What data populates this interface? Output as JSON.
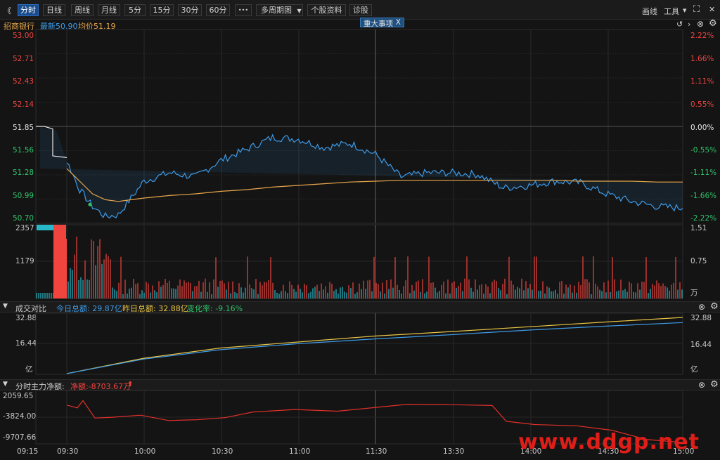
{
  "toolbar": {
    "back_glyph": "《",
    "tabs": [
      "分时",
      "日线",
      "周线",
      "月线",
      "5分",
      "15分",
      "30分",
      "60分"
    ],
    "more": "•••",
    "multi_period": "多周期图",
    "stock_info": "个股资料",
    "diagnose": "诊股",
    "draw": "画线",
    "tools": "工具",
    "expand_glyph": "⛶",
    "close_glyph": "✕"
  },
  "stock": {
    "name": "招商银行",
    "latest": "最新50.90",
    "avg": "均价51.19"
  },
  "event_tag": {
    "label": "重大事项",
    "close": "X"
  },
  "price_axis": {
    "left": [
      "53.00",
      "52.71",
      "52.43",
      "52.14",
      "51.85",
      "51.56",
      "51.28",
      "50.99",
      "50.70"
    ],
    "right": [
      "2.22%",
      "1.66%",
      "1.11%",
      "0.55%",
      "0.00%",
      "-0.55%",
      "-1.11%",
      "-1.66%",
      "-2.22%"
    ]
  },
  "volume_axis": {
    "left": [
      "2357",
      "1179"
    ],
    "right": [
      "1.51",
      "0.75",
      "万"
    ]
  },
  "panel_turnover": {
    "title": "成交对比",
    "today": "今日总额: 29.87亿",
    "yesterday": "昨日总额: 32.88亿",
    "change": "变化率: -9.16%",
    "axis_left": [
      "32.88",
      "16.44",
      "亿"
    ],
    "axis_right": [
      "32.88",
      "16.44",
      "亿"
    ]
  },
  "panel_flow": {
    "title": "分时主力净额:",
    "net": "净额:-8703.67万",
    "arrow": "⬆",
    "axis": [
      "2059.65",
      "-3824.00",
      "-9707.66"
    ]
  },
  "time_axis": [
    "09:15",
    "09:30",
    "10:00",
    "10:30",
    "11:00",
    "11:30",
    "13:30",
    "14:00",
    "14:30",
    "15:00"
  ],
  "watermark": "www.ddgp.net",
  "colors": {
    "up": "#f0443e",
    "down": "#2fc26a",
    "price_line": "#3e9be8",
    "avg_line": "#e8a64a",
    "today_line": "#3e9be8",
    "yesterday_line": "#e8c445",
    "flow_line": "#e0302a",
    "accent": "#1a4c8c"
  },
  "chart_data": [
    {
      "type": "line",
      "name": "intraday-price",
      "x": [
        "09:15",
        "09:25",
        "09:30",
        "09:35",
        "09:40",
        "09:45",
        "09:50",
        "09:55",
        "10:00",
        "10:10",
        "10:20",
        "10:30",
        "10:40",
        "10:50",
        "11:00",
        "11:10",
        "11:20",
        "11:30",
        "13:10",
        "13:20",
        "13:30",
        "13:40",
        "13:50",
        "14:00",
        "14:10",
        "14:20",
        "14:30",
        "14:40",
        "14:50",
        "15:00"
      ],
      "series": [
        {
          "values": [
            51.85,
            51.8,
            51.44,
            51.1,
            50.9,
            50.78,
            50.8,
            51.0,
            51.2,
            51.3,
            51.25,
            51.45,
            51.58,
            51.72,
            51.7,
            51.6,
            51.65,
            51.52,
            51.25,
            51.3,
            51.3,
            51.28,
            51.12,
            51.15,
            51.2,
            51.18,
            51.05,
            50.96,
            50.9,
            50.88
          ]
        },
        {
          "values": [
            51.85,
            51.8,
            51.35,
            51.2,
            51.05,
            50.98,
            50.96,
            50.98,
            51.0,
            51.03,
            51.05,
            51.08,
            51.1,
            51.13,
            51.15,
            51.17,
            51.19,
            51.2,
            51.21,
            51.21,
            51.21,
            51.21,
            51.21,
            51.21,
            51.21,
            51.2,
            51.2,
            51.2,
            51.19,
            51.19
          ]
        }
      ],
      "ylim": [
        50.7,
        53.0
      ]
    },
    {
      "type": "bar",
      "name": "volume",
      "ylim": [
        0,
        2357
      ]
    },
    {
      "type": "line",
      "name": "turnover-compare",
      "series": [
        {
          "name": "今日总额",
          "values": [
            0,
            8.5,
            14.0,
            17.5,
            20.3,
            22.8,
            25.5,
            27.8,
            29.87
          ]
        },
        {
          "name": "昨日总额",
          "values": [
            0,
            9.0,
            15.0,
            18.5,
            22.0,
            24.6,
            27.4,
            30.2,
            32.88
          ]
        }
      ],
      "ylim": [
        0,
        32.88
      ]
    },
    {
      "type": "line",
      "name": "main-net-flow",
      "values": [
        -500,
        -1200,
        600,
        -3700,
        -3500,
        -3000,
        -4300,
        -4100,
        -3600,
        -2200,
        -1600,
        -2000,
        -300,
        -400,
        -600,
        -4500,
        -5300,
        -5600,
        -6700,
        -9000,
        -9700
      ],
      "ylim": [
        -9707.66,
        2059.65
      ]
    }
  ]
}
